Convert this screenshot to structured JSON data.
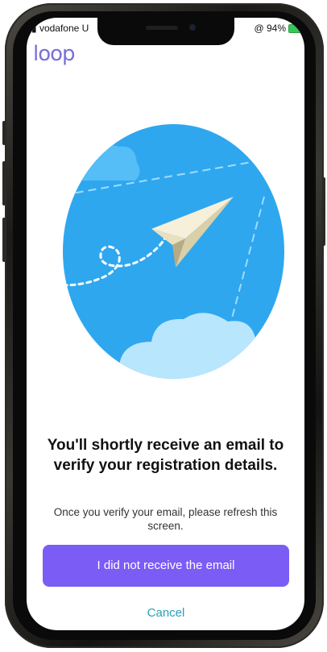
{
  "status_bar": {
    "carrier": "vodafone U",
    "battery_percent": "@ 94%"
  },
  "brand": {
    "logo_text": "loop",
    "logo_color": "#7a6fd8"
  },
  "illustration": {
    "icon": "paper-plane-icon",
    "sky_color": "#2ea7ef"
  },
  "content": {
    "headline": "You'll shortly receive an email to verify your registration details.",
    "subtext": "Once you verify your email, please refresh this screen."
  },
  "actions": {
    "primary_label": "I did not receive the email",
    "primary_color": "#7b5cf5",
    "cancel_label": "Cancel",
    "cancel_color": "#2aa1b3"
  }
}
